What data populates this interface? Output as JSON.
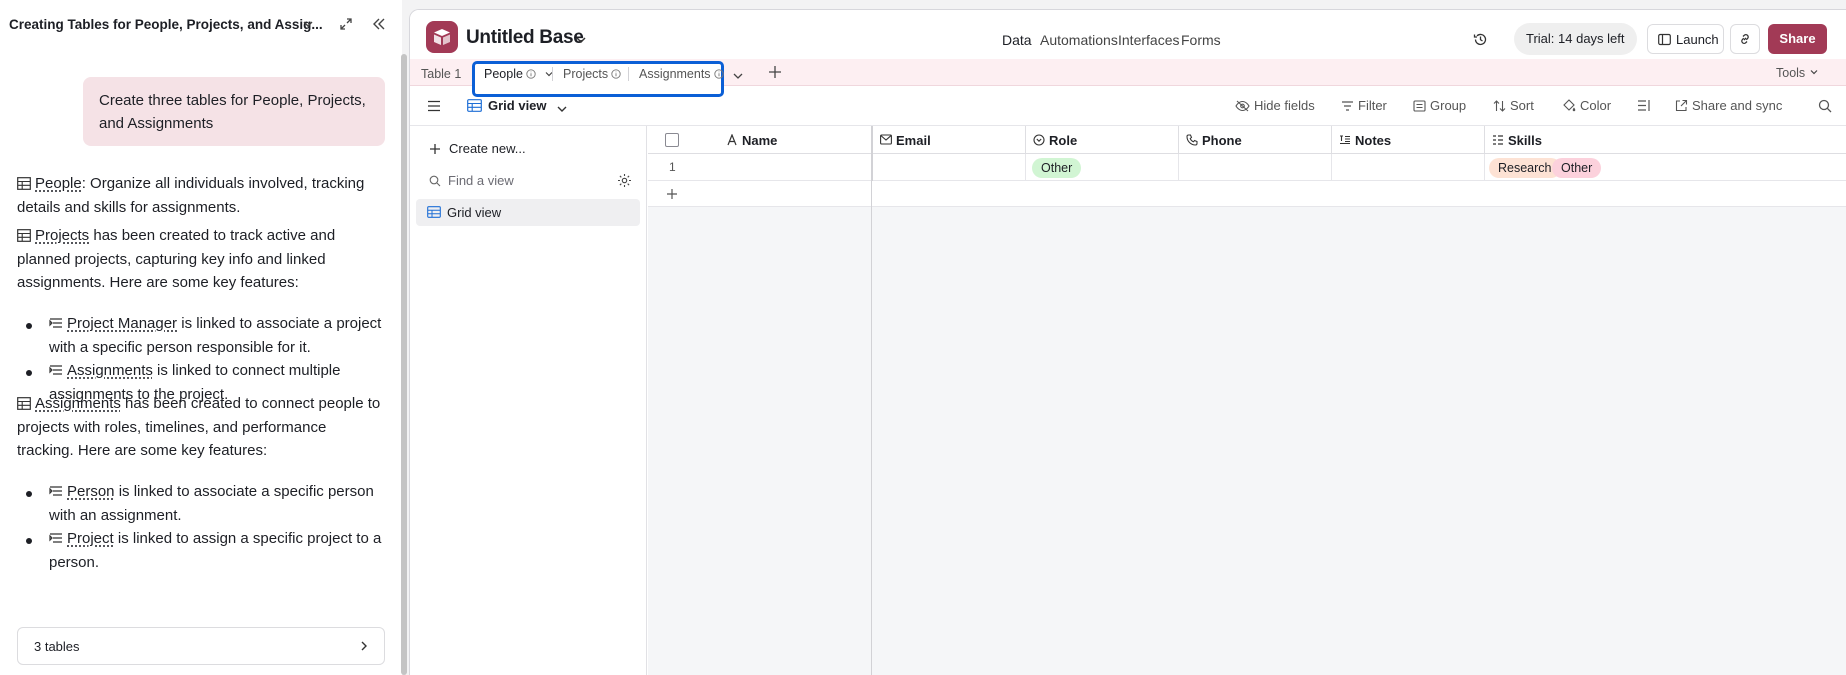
{
  "left_panel": {
    "title": "Creating Tables for People, Projects, and Assig...",
    "user_message": "Create three tables for People, Projects, and Assignments",
    "people_name": "People",
    "people_desc": ": Organize all individuals involved, tracking details and skills for assignments.",
    "projects_name": "Projects",
    "projects_desc": " has been created to track active and planned projects, capturing key info and linked assignments. Here are some key features:",
    "projects_features": [
      {
        "name": "Project Manager",
        "desc": " is linked to associate a project with a specific person responsible for it."
      },
      {
        "name": "Assignments",
        "desc": " is linked to connect multiple assignments to the project."
      }
    ],
    "assignments_name": "Assignments",
    "assignments_desc": " has been created to connect people to projects with roles, timelines, and performance tracking. Here are some key features:",
    "assignments_features": [
      {
        "name": "Person",
        "desc": " is linked to associate a specific person with an assignment."
      },
      {
        "name": "Project",
        "desc": " is linked to assign a specific project to a person."
      }
    ],
    "tables_chip": "3 tables"
  },
  "topbar": {
    "base_name": "Untitled Base",
    "nav": [
      "Data",
      "Automations",
      "Interfaces",
      "Forms"
    ],
    "trial": "Trial: 14 days left",
    "launch": "Launch",
    "share": "Share"
  },
  "tabs": {
    "table1": "Table 1",
    "items": [
      "People",
      "Projects",
      "Assignments"
    ],
    "tools": "Tools"
  },
  "viewbar": {
    "view_name": "Grid view",
    "tools": [
      "Hide fields",
      "Filter",
      "Group",
      "Sort",
      "Color",
      "Share and sync"
    ]
  },
  "sidebar": {
    "create_new": "Create new...",
    "find_placeholder": "Find a view",
    "views": [
      "Grid view"
    ]
  },
  "grid": {
    "columns": [
      "Name",
      "Email",
      "Role",
      "Phone",
      "Notes",
      "Skills"
    ],
    "rows": [
      {
        "num": "1",
        "name": "",
        "email": "",
        "role": "Other",
        "phone": "",
        "notes": "",
        "skills": [
          "Research",
          "Other"
        ]
      }
    ]
  },
  "colors": {
    "accent": "#a23a56",
    "tab_bar": "#fdeff2",
    "highlight": "#0b5fd6",
    "pill_role_other": "#d1f5d3",
    "pill_skill_research": "#fde2d4",
    "pill_skill_other": "#fcd1dc"
  }
}
